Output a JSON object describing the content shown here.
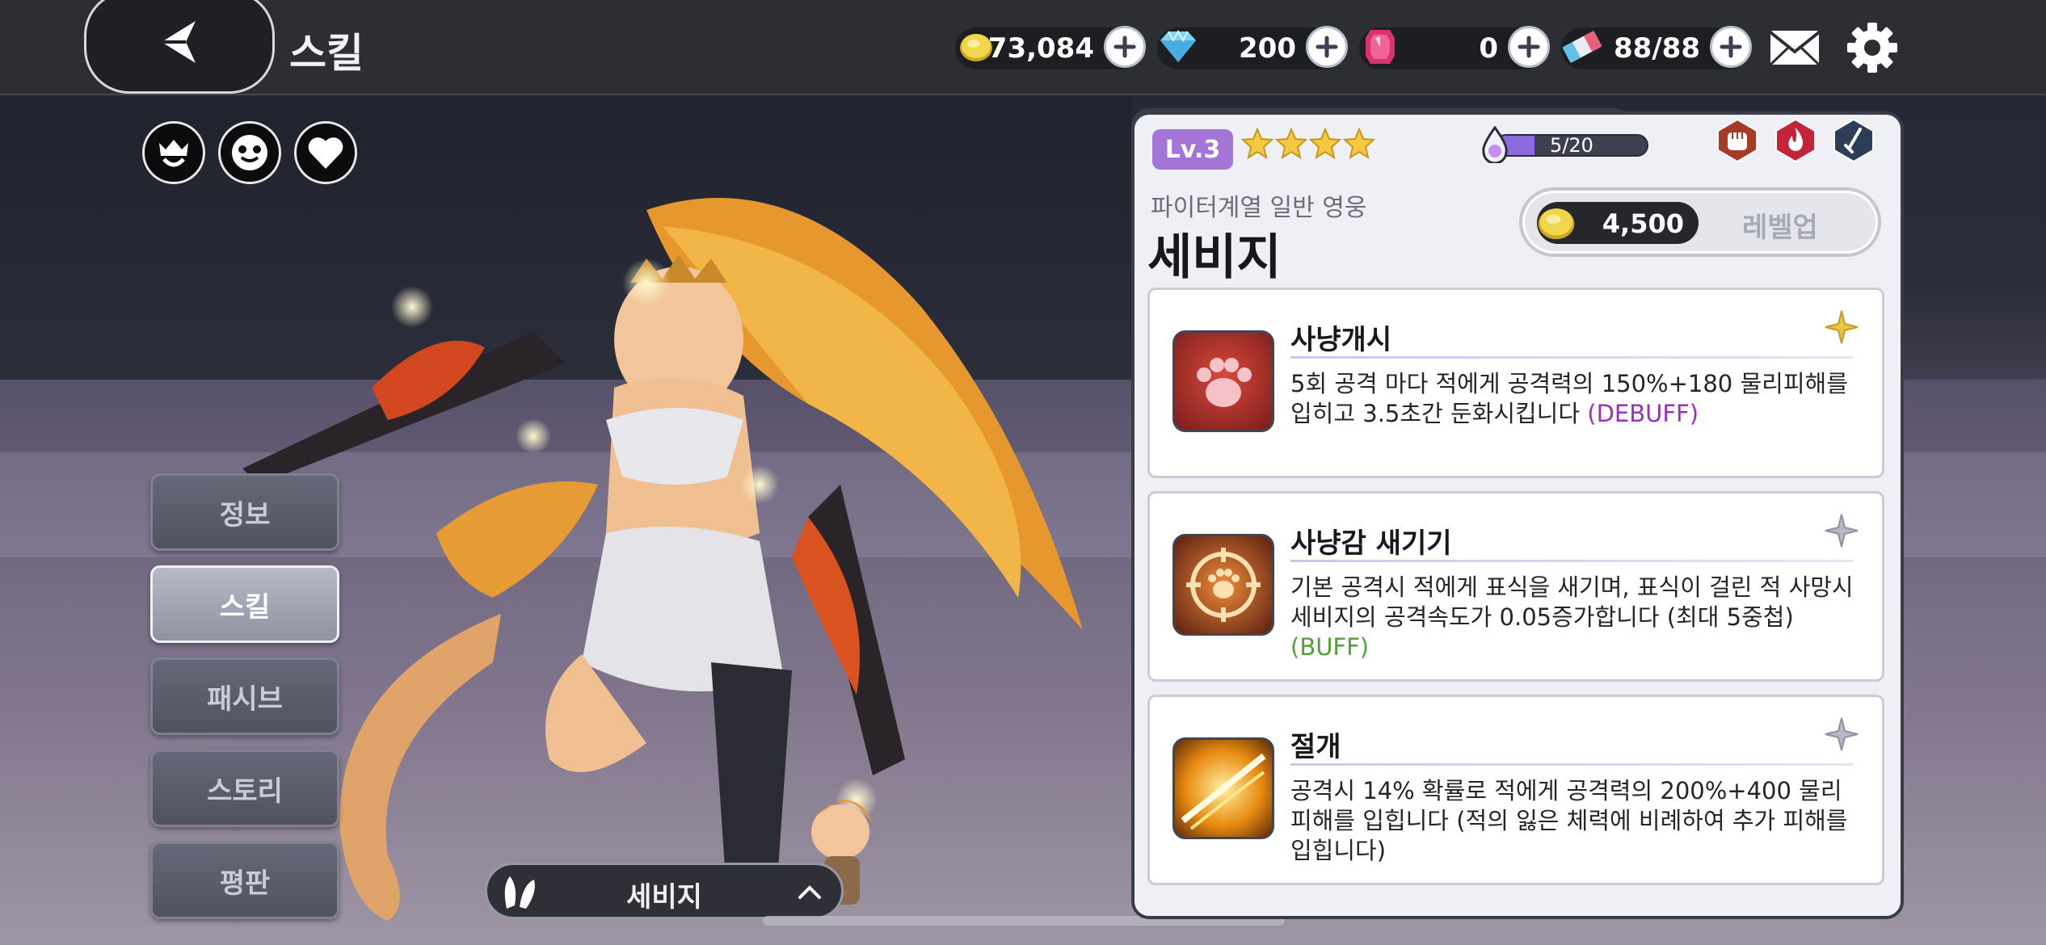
{
  "header": {
    "title": "스킬"
  },
  "resources": [
    {
      "name": "gold",
      "value": "73,084"
    },
    {
      "name": "diamond",
      "value": "200"
    },
    {
      "name": "ruby",
      "value": "0"
    },
    {
      "name": "ticket",
      "value": "88/88"
    }
  ],
  "side_menu": [
    {
      "label": "정보",
      "active": false
    },
    {
      "label": "스킬",
      "active": true
    },
    {
      "label": "패시브",
      "active": false
    },
    {
      "label": "스토리",
      "active": false
    },
    {
      "label": "평판",
      "active": false
    }
  ],
  "selector": {
    "name": "세비지"
  },
  "hero": {
    "level": "Lv.3",
    "stars": 4,
    "exp_text": "5/20",
    "exp_fraction": 0.25,
    "class_text": "파이터계열 일반 영웅",
    "name": "세비지",
    "levelup_cost": "4,500",
    "levelup_label": "레벨업"
  },
  "skills": [
    {
      "name": "사냥개시",
      "desc_main": "5회 공격 마다 적에게 공격력의 150%+180 물리피해를 입히고 3.5초간 둔화시킵니다",
      "tag": "(DEBUFF)"
    },
    {
      "name": "사냥감 새기기",
      "desc_main": "기본 공격시 적에게 표식을 새기며, 표식이 걸린 적 사망시 세비지의 공격속도가 0.05증가합니다 (최대 5중첩)",
      "tag": "(BUFF)"
    },
    {
      "name": "절개",
      "desc_main": "공격시 14% 확률로 적에게 공격력의 200%+400 물리피해를 입힙니다 (적의 잃은 체력에 비례하여 추가 피해를 입힙니다)",
      "tag": ""
    }
  ],
  "colors": {
    "level_badge": "#a275d6",
    "debuff": "#9a2fc2",
    "buff": "#52a13a"
  }
}
